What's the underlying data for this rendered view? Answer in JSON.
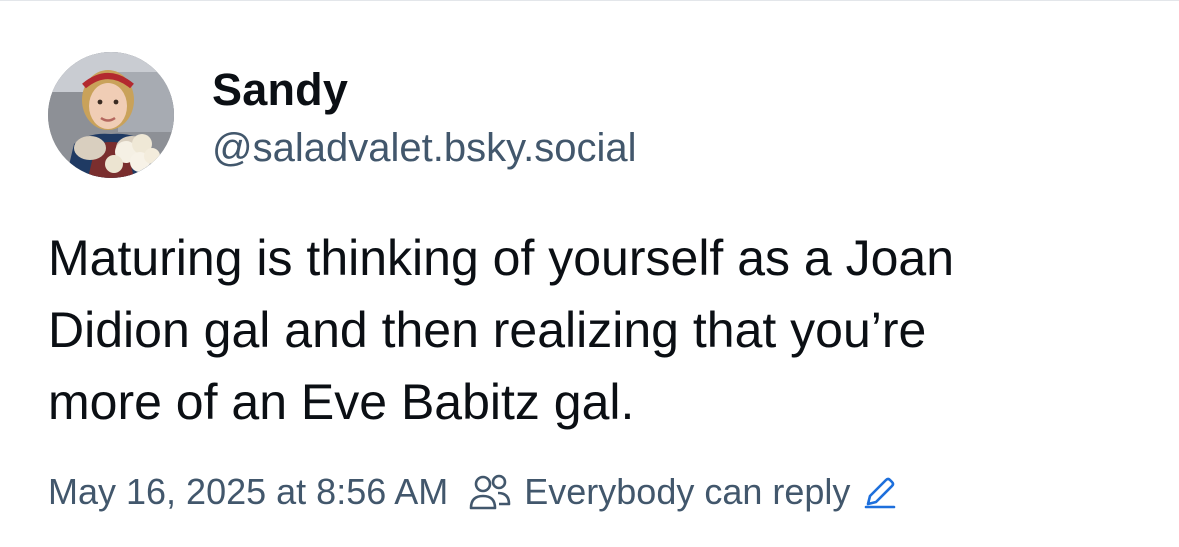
{
  "author": {
    "display_name": "Sandy",
    "handle": "@saladvalet.bsky.social",
    "avatar_icon": "avatar-photo"
  },
  "post": {
    "text": "Maturing is thinking of yourself as a Joan\nDidion gal and then realizing that you’re\nmore of an Eve Babitz gal."
  },
  "meta": {
    "timestamp": "May 16, 2025 at 8:56 AM",
    "reply_setting_label": "Everybody can reply",
    "reply_icon": "people-icon",
    "edit_icon": "pencil-icon"
  },
  "colors": {
    "text_primary": "#0b0f14",
    "text_secondary": "#42576c",
    "link": "#1d6fdc",
    "divider": "#e3e6ea"
  }
}
